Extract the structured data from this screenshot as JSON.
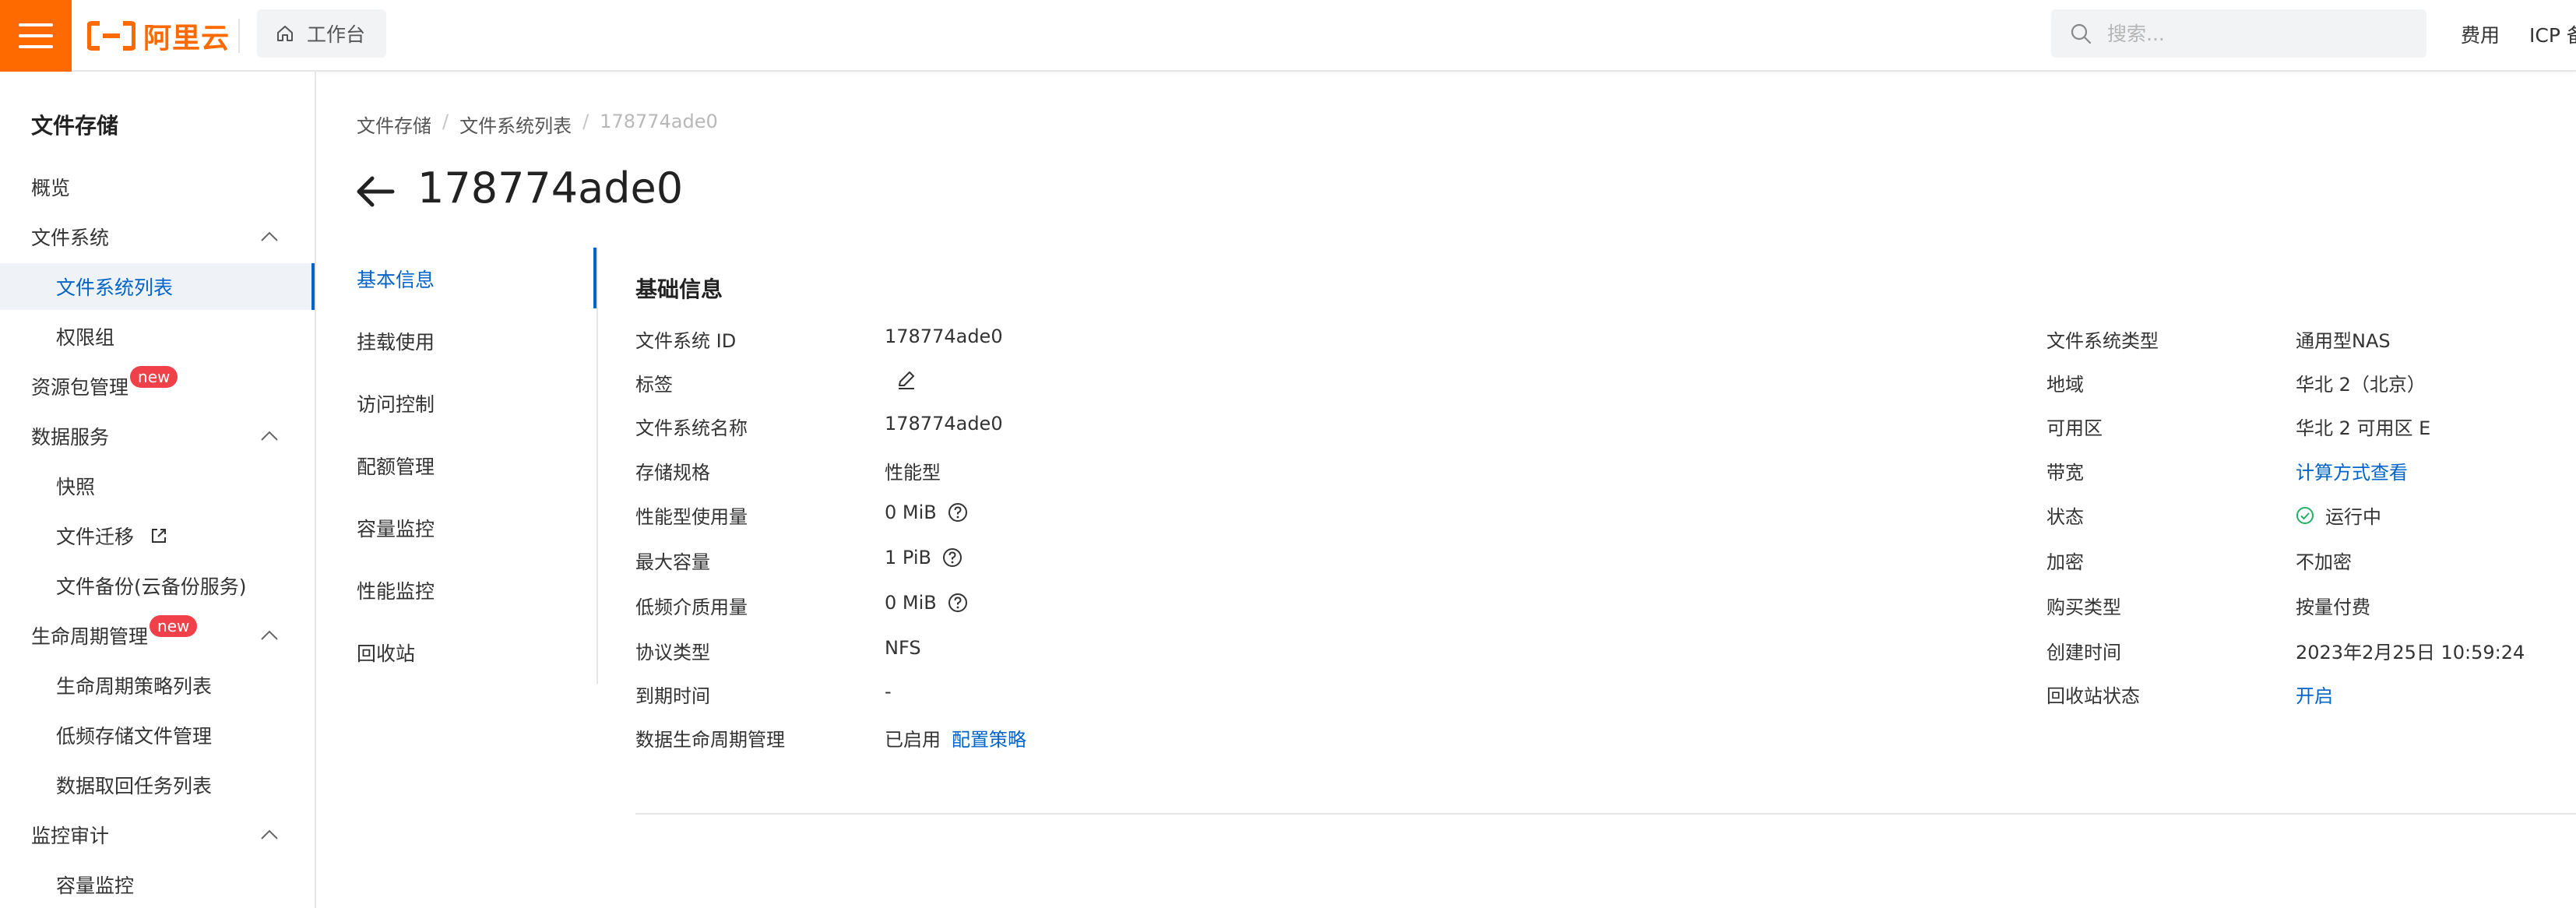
{
  "app": {
    "logo_text": "阿里云",
    "workbench_label": "工作台",
    "brand_color": "#ff6a00",
    "link_color": "#0064c8"
  },
  "header": {
    "search_placeholder": "搜索...",
    "links": [
      "费用",
      "ICP 备"
    ]
  },
  "sidebar": {
    "title": "文件存储",
    "items": [
      {
        "label": "概览"
      },
      {
        "label": "文件系统"
      },
      {
        "label": "文件系统列表"
      },
      {
        "label": "权限组"
      },
      {
        "label": "资源包管理",
        "badge": "new"
      },
      {
        "label": "数据服务"
      },
      {
        "label": "快照"
      },
      {
        "label": "文件迁移"
      },
      {
        "label": "文件备份(云备份服务)"
      },
      {
        "label": "生命周期管理",
        "badge": "new"
      },
      {
        "label": "生命周期策略列表"
      },
      {
        "label": "低频存储文件管理"
      },
      {
        "label": "数据取回任务列表"
      },
      {
        "label": "监控审计"
      },
      {
        "label": "容量监控"
      }
    ]
  },
  "breadcrumb": {
    "items": [
      "文件存储",
      "文件系统列表",
      "178774ade0"
    ],
    "separator": "/"
  },
  "page": {
    "title": "178774ade0"
  },
  "subnav": {
    "items": [
      "基本信息",
      "挂载使用",
      "访问控制",
      "配额管理",
      "容量监控",
      "性能监控",
      "回收站"
    ]
  },
  "basic_info": {
    "title": "基础信息",
    "left": [
      {
        "label": "文件系统 ID",
        "value": "178774ade0"
      },
      {
        "label": "标签",
        "value": ""
      },
      {
        "label": "文件系统名称",
        "value": "178774ade0"
      },
      {
        "label": "存储规格",
        "value": "性能型"
      },
      {
        "label": "性能型使用量",
        "value": "0 MiB"
      },
      {
        "label": "最大容量",
        "value": "1 PiB"
      },
      {
        "label": "低频介质用量",
        "value": "0 MiB"
      },
      {
        "label": "协议类型",
        "value": "NFS"
      },
      {
        "label": "到期时间",
        "value": "-"
      },
      {
        "label": "数据生命周期管理",
        "value": "已启用",
        "link": "配置策略"
      }
    ],
    "right": [
      {
        "label": "文件系统类型",
        "value": "通用型NAS"
      },
      {
        "label": "地域",
        "value": "华北 2（北京）"
      },
      {
        "label": "可用区",
        "value": "华北 2 可用区 E"
      },
      {
        "label": "带宽",
        "link": "计算方式查看"
      },
      {
        "label": "状态",
        "value": "运行中",
        "status_color": "#23b066"
      },
      {
        "label": "加密",
        "value": "不加密"
      },
      {
        "label": "购买类型",
        "value": "按量付费"
      },
      {
        "label": "创建时间",
        "value": "2023年2月25日 10:59:24"
      },
      {
        "label": "回收站状态",
        "link": "开启"
      }
    ]
  }
}
